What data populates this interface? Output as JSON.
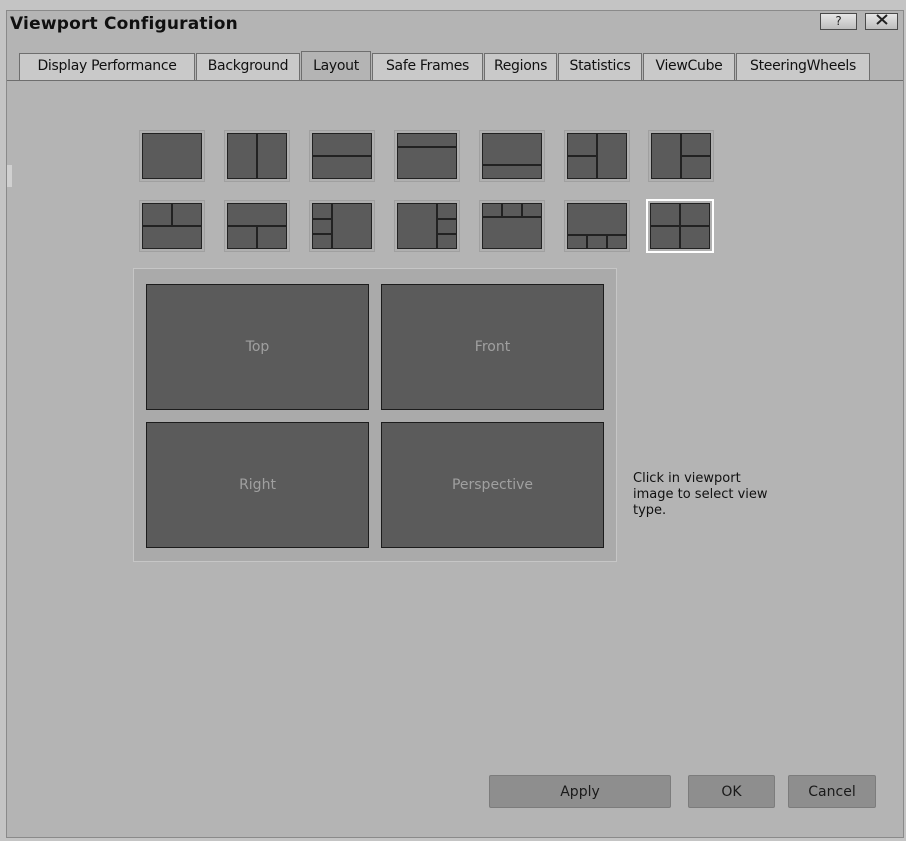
{
  "window": {
    "title": "Viewport Configuration",
    "help_button": "?",
    "close_button": "X"
  },
  "tabs": [
    {
      "label": "Display Performance",
      "active": false
    },
    {
      "label": "Background",
      "active": false
    },
    {
      "label": "Layout",
      "active": true
    },
    {
      "label": "Safe Frames",
      "active": false
    },
    {
      "label": "Regions",
      "active": false
    },
    {
      "label": "Statistics",
      "active": false
    },
    {
      "label": "ViewCube",
      "active": false
    },
    {
      "label": "SteeringWheels",
      "active": false
    }
  ],
  "layouts": {
    "count": 14,
    "selected_index": 13
  },
  "viewports": {
    "top_left": "Top",
    "top_right": "Front",
    "bottom_left": "Right",
    "bottom_right": "Perspective"
  },
  "hint": "Click in viewport image to select view type.",
  "buttons": {
    "apply": "Apply",
    "ok": "OK",
    "cancel": "Cancel"
  },
  "colors": {
    "viewport_fill": "#5b5b5b",
    "dialog_bg": "#b4b4b4",
    "selection_border": "#ffffff"
  }
}
